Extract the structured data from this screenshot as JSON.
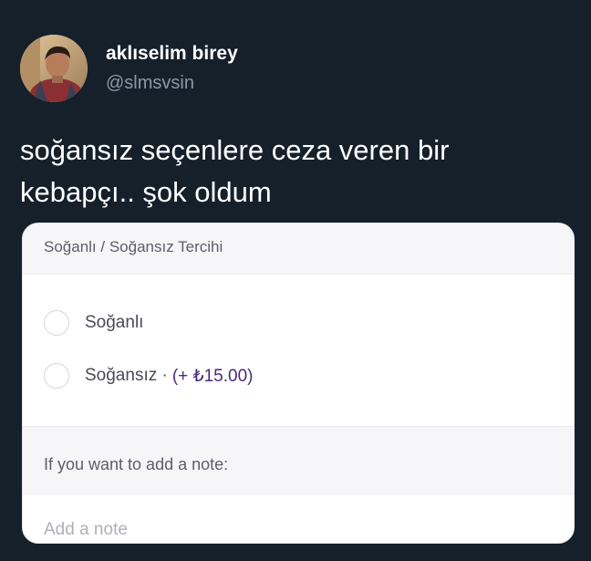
{
  "tweet": {
    "display_name": "aklıselim birey",
    "handle": "@slmsvsin",
    "text_line1": "soğansız seçenlere ceza veren bir",
    "text_line2": "kebapçı.. şok oldum"
  },
  "card": {
    "header": "Soğanlı / Soğansız Tercihi",
    "options": [
      {
        "label": "Soğanlı",
        "price": ""
      },
      {
        "label": "Soğansız ·",
        "price": "(+ ₺15.00)"
      }
    ],
    "note_label": "If you want to add a note:",
    "note_placeholder": "Add a note"
  },
  "colors": {
    "background": "#15202b",
    "text_primary": "#ffffff",
    "text_secondary": "#8b98a5",
    "price_accent": "#4a2b7a"
  },
  "icons": {
    "avatar": "profile-photo"
  }
}
